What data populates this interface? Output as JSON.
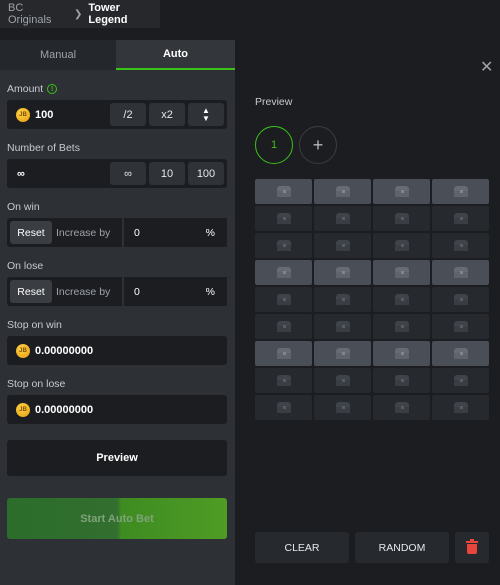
{
  "breadcrumb": {
    "parent": "BC Originals",
    "current": "Tower Legend"
  },
  "tabs": {
    "manual": "Manual",
    "auto": "Auto",
    "active": "Auto"
  },
  "amount": {
    "label": "Amount",
    "value": "100",
    "half": "/2",
    "double": "x2",
    "info_icon": "info-icon",
    "coin": "JB"
  },
  "number_of_bets": {
    "label": "Number of Bets",
    "value": "∞",
    "presets": [
      "∞",
      "10",
      "100"
    ]
  },
  "on_win": {
    "label": "On win",
    "reset": "Reset",
    "mode": "Increase by",
    "value": "0",
    "unit": "%"
  },
  "on_lose": {
    "label": "On lose",
    "reset": "Reset",
    "mode": "Increase by",
    "value": "0",
    "unit": "%"
  },
  "stop_on_win": {
    "label": "Stop on win",
    "value": "0.00000000",
    "coin": "JB"
  },
  "stop_on_lose": {
    "label": "Stop on lose",
    "value": "0.00000000",
    "coin": "JB"
  },
  "buttons": {
    "preview": "Preview",
    "start_auto_bet": "Start Auto Bet",
    "clear": "CLEAR",
    "random": "RANDOM"
  },
  "right_panel": {
    "preview_label": "Preview",
    "rounds": [
      "1"
    ],
    "add_icon": "plus-icon",
    "close_icon": "close-icon",
    "highlighted_rows": [
      1,
      4,
      7
    ],
    "grid_rows": 9,
    "grid_cols": 4
  },
  "colors": {
    "accent": "#3bc117",
    "danger": "#e8463c",
    "panel": "#2d3035",
    "background": "#1b1d21"
  }
}
